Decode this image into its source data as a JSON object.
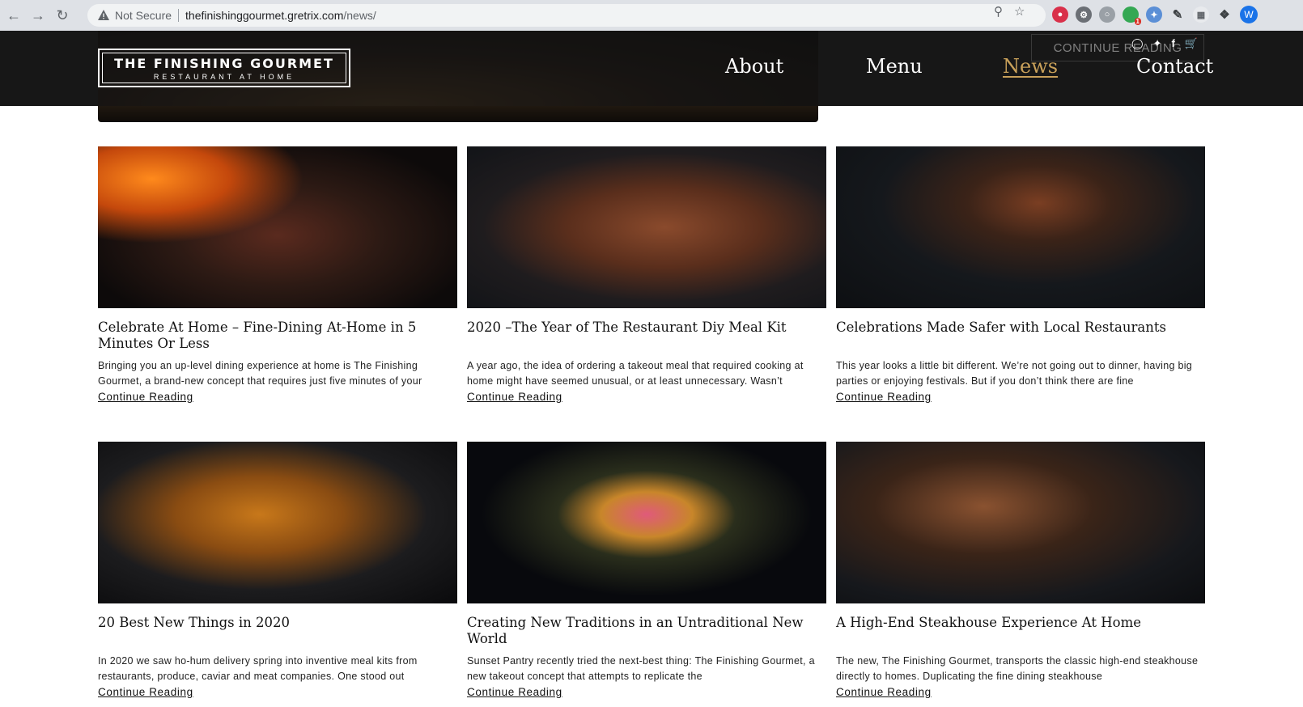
{
  "browser": {
    "security_label": "Not Secure",
    "url_host": "thefinishinggourmet.gretrix.com",
    "url_path": "/news/",
    "profile_initial": "W",
    "extension_badge": "1"
  },
  "site": {
    "logo_line1": "THE FINISHING GOURMET",
    "logo_line2": "RESTAURANT AT HOME",
    "nav": [
      "About",
      "Menu",
      "News",
      "Contact"
    ],
    "active_nav": "News",
    "ghost_cta": "CONTINUE READING"
  },
  "posts": [
    {
      "title": "Celebrate At Home – Fine-Dining At-Home in 5 Minutes Or Less",
      "excerpt": "Bringing you an up-level dining experience at home is The Finishing Gourmet, a brand-new concept that requires just five minutes of your",
      "more": "Continue Reading"
    },
    {
      "title": "2020 –The Year of The Restaurant Diy Meal Kit",
      "excerpt": "A year ago, the idea of ordering a takeout meal that required cooking at home might have seemed unusual, or at least unnecessary. Wasn’t",
      "more": "Continue Reading"
    },
    {
      "title": "Celebrations Made Safer with Local Restaurants",
      "excerpt": "This year looks a little bit different. We’re not going out to dinner, having big parties or enjoying festivals. But if you don’t think there are fine",
      "more": "Continue Reading"
    },
    {
      "title": "20 Best New Things in 2020",
      "excerpt": "In 2020 we saw ho-hum delivery spring into inventive meal kits from restaurants, produce, caviar and meat companies. One stood out",
      "more": "Continue Reading"
    },
    {
      "title": "Creating New Traditions in an Untraditional New World",
      "excerpt": "Sunset Pantry recently tried the next-best thing: The Finishing Gourmet, a new takeout concept that attempts to replicate the",
      "more": "Continue Reading"
    },
    {
      "title": "A High-End Steakhouse Experience At Home",
      "excerpt": "The new, The Finishing Gourmet, transports the classic high-end steakhouse directly to homes. Duplicating the fine dining steakhouse",
      "more": "Continue Reading"
    }
  ]
}
